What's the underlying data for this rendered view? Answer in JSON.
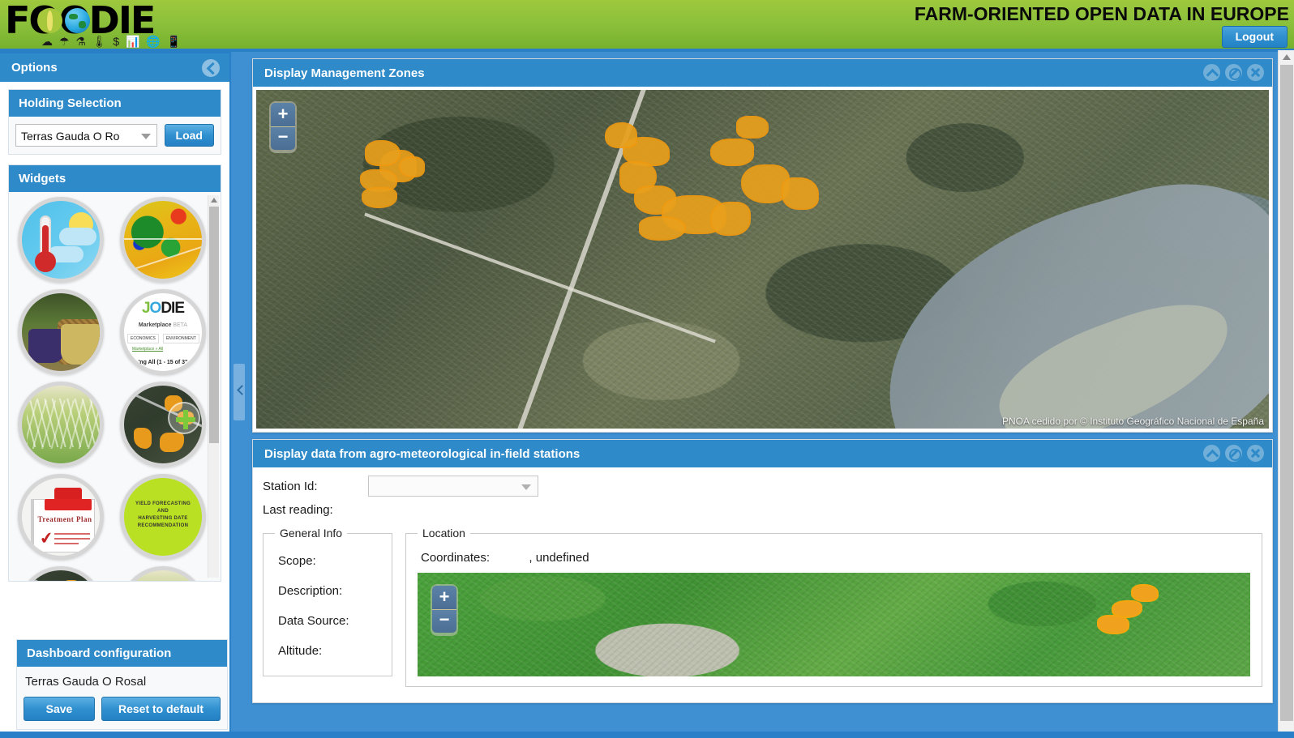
{
  "header": {
    "logo_text": "FOODIE",
    "logo_icons": "☁ ☂ ⚗ 🌡 $ 📊 🌐 📱",
    "title": "FARM-ORIENTED OPEN DATA IN EUROPE",
    "logout_label": "Logout"
  },
  "sidebar": {
    "options_title": "Options",
    "collapse_icon": "chevron-left-icon",
    "holding": {
      "title": "Holding Selection",
      "selected": "Terras Gauda O Ro",
      "load_label": "Load"
    },
    "widgets": {
      "title": "Widgets",
      "items": [
        {
          "name": "weather-widget",
          "label": "Weather"
        },
        {
          "name": "ndvi-map-widget",
          "label": "NDVI Index Map"
        },
        {
          "name": "grapes-harvest-widget",
          "label": "Grape Harvest"
        },
        {
          "name": "jodie-marketplace-widget",
          "label": "JODIE Marketplace BETA",
          "logo_j": "J",
          "logo_o": "O",
          "logo_die": "DIE",
          "subtitle": "Marketplace",
          "beta": "BETA",
          "tabs": [
            "ECONOMICS",
            "ENVIRONMENT"
          ],
          "link": "Marketplace » All",
          "footer": "'ng All (1 - 15 of 3\""
        },
        {
          "name": "irrigation-widget",
          "label": "Irrigation"
        },
        {
          "name": "management-zones-widget",
          "label": "Management Zones"
        },
        {
          "name": "treatment-plan-widget",
          "label": "Treatment Plan",
          "title_text": "Treatment Plan"
        },
        {
          "name": "yield-forecast-widget",
          "label": "Yield Forecasting",
          "text": "YIELD FORECASTING\nAND\nHARVESTING DATE\nRECOMMENDATION"
        }
      ]
    },
    "dashboard": {
      "title": "Dashboard configuration",
      "name": "Terras Gauda O Rosal",
      "save_label": "Save",
      "reset_label": "Reset to default"
    }
  },
  "main": {
    "card1": {
      "title": "Display Management Zones",
      "tools": [
        "collapse-icon",
        "block-icon",
        "close-icon"
      ],
      "zoom_in": "+",
      "zoom_out": "−",
      "attribution": "PNOA cedido por © Instituto Geográfico Nacional de España"
    },
    "card2": {
      "title": "Display data from agro-meteorological in-field stations",
      "tools": [
        "collapse-icon",
        "block-icon",
        "close-icon"
      ],
      "station_label": "Station Id:",
      "station_value": "",
      "last_reading_label": "Last reading:",
      "general_info": {
        "legend": "General Info",
        "fields": [
          "Scope:",
          "Description:",
          "Data Source:",
          "Altitude:"
        ]
      },
      "location": {
        "legend": "Location",
        "coordinates_label": "Coordinates:",
        "coordinates_value": ", undefined",
        "zoom_in": "+",
        "zoom_out": "−"
      }
    }
  },
  "colors": {
    "header_green": "#8dc13c",
    "panel_blue": "#2e8ac8",
    "zone_orange": "#e8a01c",
    "button_blue": "#2f8fcf"
  }
}
